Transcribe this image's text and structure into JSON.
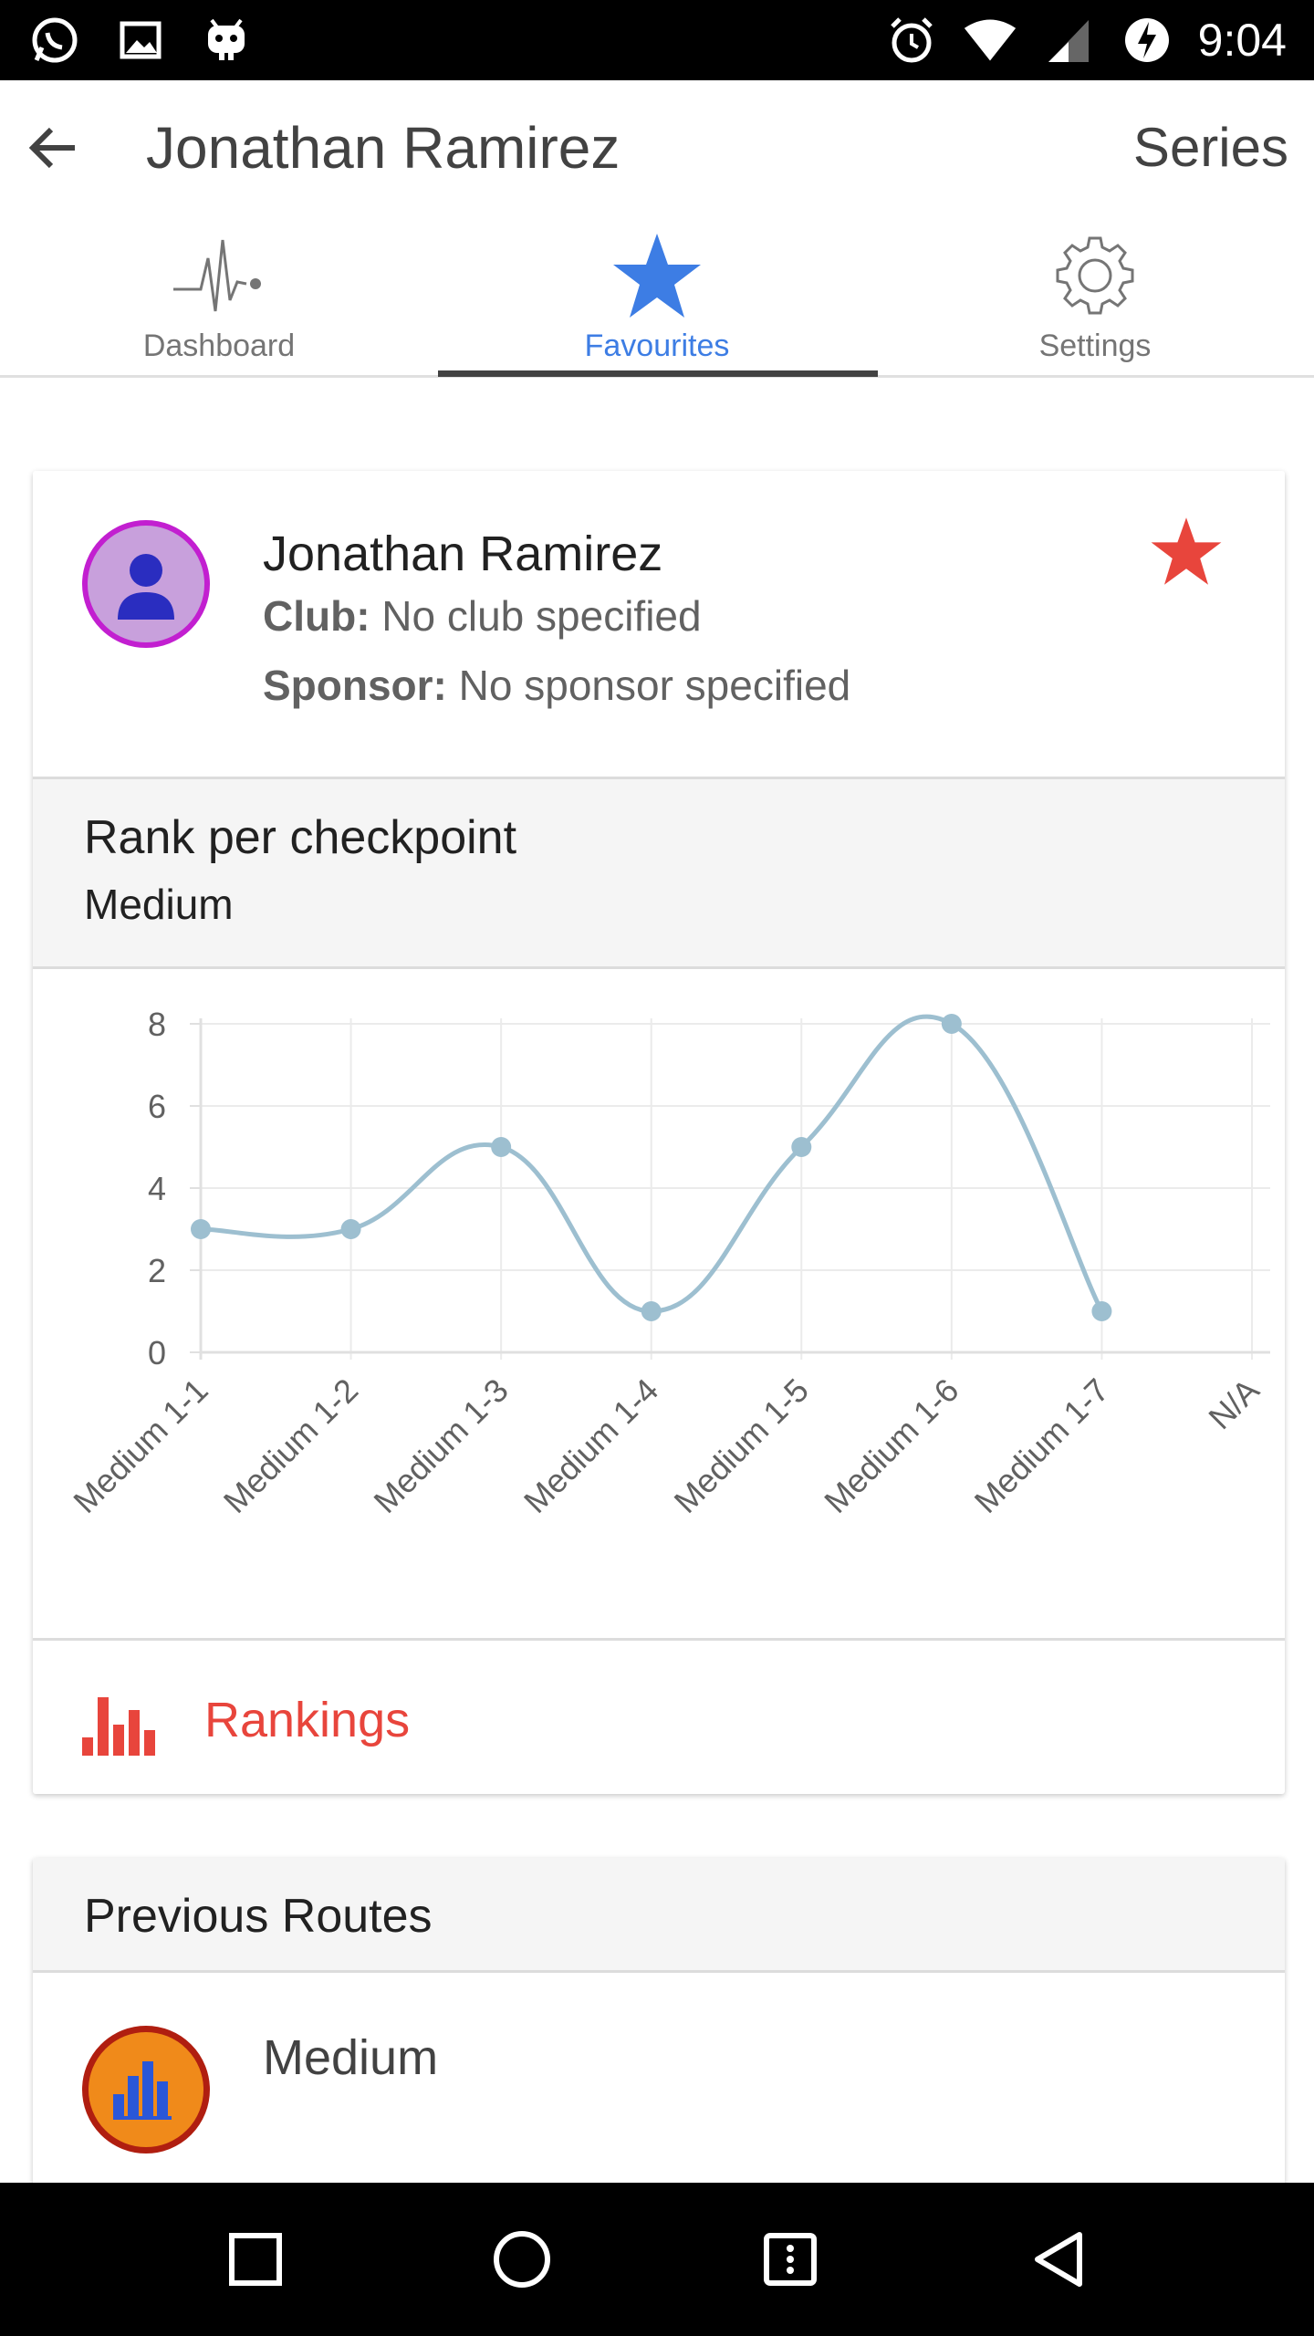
{
  "status_bar": {
    "time": "9:04",
    "left_icons": [
      "whatsapp-icon",
      "gallery-icon",
      "android-debug-icon"
    ],
    "right_icons": [
      "alarm-icon",
      "wifi-icon",
      "signal-icon",
      "battery-charging-icon"
    ]
  },
  "app_bar": {
    "title": "Jonathan Ramirez",
    "action": "Series",
    "back_icon": "arrow-back-icon"
  },
  "tabs": [
    {
      "label": "Dashboard",
      "icon": "pulse-icon",
      "active": false
    },
    {
      "label": "Favourites",
      "icon": "star-icon",
      "active": true
    },
    {
      "label": "Settings",
      "icon": "gear-icon",
      "active": false
    }
  ],
  "colors": {
    "accent_blue": "#3d7de4",
    "favorite_red": "#e8453c",
    "chart_line": "#9dbfd0",
    "avatar_border": "#c21fd0",
    "route_avatar": "#f08a1a"
  },
  "profile": {
    "name": "Jonathan Ramirez",
    "club_label": "Club:",
    "club_value": "No club specified",
    "sponsor_label": "Sponsor:",
    "sponsor_value": "No sponsor specified",
    "favorited": true
  },
  "rank_section": {
    "title": "Rank per checkpoint",
    "subtitle": "Medium"
  },
  "chart_data": {
    "type": "line",
    "categories": [
      "Medium 1-1",
      "Medium 1-2",
      "Medium 1-3",
      "Medium 1-4",
      "Medium 1-5",
      "Medium 1-6",
      "Medium 1-7",
      "N/A"
    ],
    "series": [
      {
        "values": [
          3,
          3,
          5,
          1,
          5,
          8,
          1,
          null
        ]
      }
    ],
    "yticks": [
      "0",
      "2",
      "4",
      "6",
      "8"
    ],
    "ylim": [
      0,
      8
    ],
    "grid": true,
    "smooth": true,
    "title": "",
    "xlabel": "",
    "ylabel": ""
  },
  "rankings": {
    "label": "Rankings",
    "icon": "bar-chart-icon"
  },
  "previous_routes": {
    "title": "Previous Routes",
    "items": [
      {
        "name": "Medium",
        "icon": "bar-chart-icon"
      }
    ]
  },
  "nav_bar": {
    "buttons": [
      "recents-icon",
      "home-icon",
      "menu-icon",
      "back-icon"
    ]
  }
}
